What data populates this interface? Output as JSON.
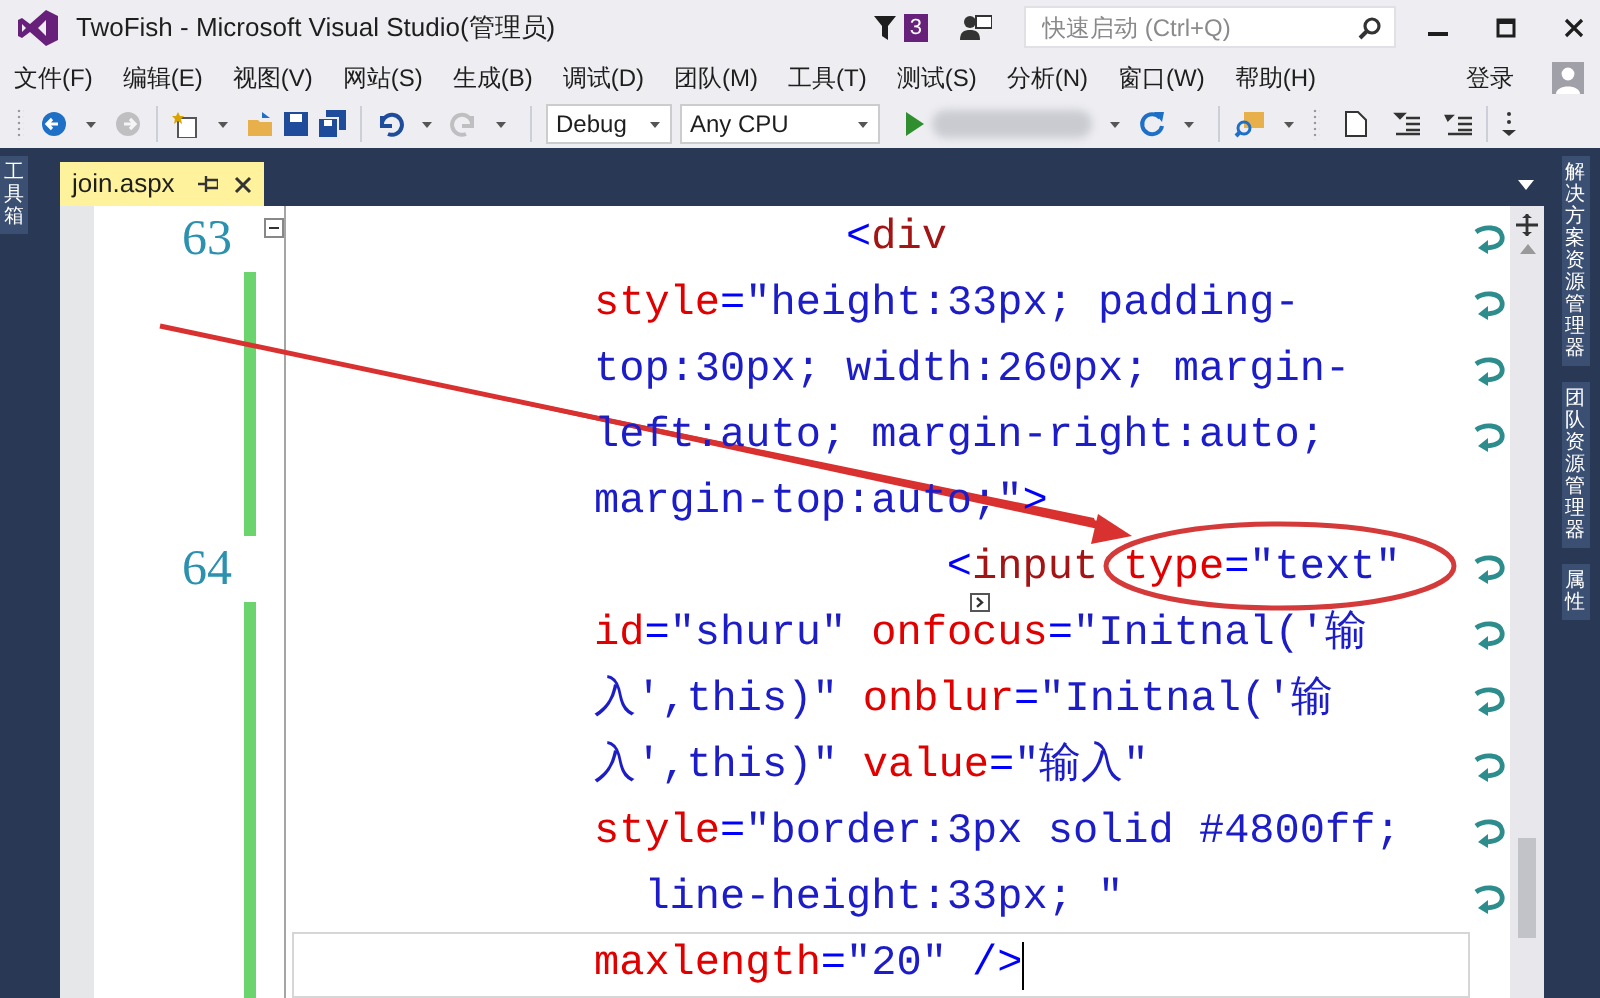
{
  "window": {
    "title": "TwoFish - Microsoft Visual Studio(管理员)",
    "notification_count": "3",
    "quick_launch": {
      "placeholder": "快速启动 (Ctrl+Q)"
    }
  },
  "menu": [
    "文件(F)",
    "编辑(E)",
    "视图(V)",
    "网站(S)",
    "生成(B)",
    "调试(D)",
    "团队(M)",
    "工具(T)",
    "测试(S)",
    "分析(N)",
    "窗口(W)",
    "帮助(H)"
  ],
  "sign_in": "登录",
  "toolbar": {
    "buttons": [
      {
        "kind": "back",
        "disabled": false
      },
      {
        "kind": "forward",
        "disabled": true
      },
      {
        "kind": "new",
        "disabled": false
      },
      {
        "kind": "open",
        "disabled": false
      },
      {
        "kind": "save",
        "disabled": false
      },
      {
        "kind": "save_all",
        "disabled": false
      },
      {
        "kind": "undo",
        "disabled": false
      },
      {
        "kind": "redo",
        "disabled": true
      }
    ],
    "configuration": "Debug",
    "platform": "Any CPU"
  },
  "left_panel": {
    "label": "工具箱"
  },
  "tabs": [
    {
      "label": "join.aspx",
      "selected": true
    }
  ],
  "editor": {
    "lines": [
      {
        "number": "63",
        "collapse_box": {
          "expanded": true
        },
        "changed": true,
        "rows": [
          {
            "current": false,
            "segments": [
              {
                "kind": "punct",
                "text": "          <"
              },
              {
                "kind": "tag",
                "text": "div"
              }
            ]
          },
          {
            "current": false,
            "segments": [
              {
                "kind": "attr",
                "text": "style"
              },
              {
                "kind": "punct",
                "text": "="
              },
              {
                "kind": "value",
                "text": "\"height:33px; padding-"
              }
            ]
          },
          {
            "current": false,
            "segments": [
              {
                "kind": "value",
                "text": "top:30px; width:260px; margin-"
              }
            ]
          },
          {
            "current": false,
            "segments": [
              {
                "kind": "value",
                "text": "left:auto; margin-right:auto;"
              }
            ]
          },
          {
            "current": false,
            "segments": [
              {
                "kind": "value",
                "text": "margin-top:auto;\""
              },
              {
                "kind": "punct",
                "text": ">"
              }
            ]
          }
        ]
      },
      {
        "number": "64",
        "changed": true,
        "rows": [
          {
            "current": false,
            "segments": [
              {
                "kind": "punct",
                "text": "              <"
              },
              {
                "kind": "tag",
                "text": "input"
              },
              {
                "kind": "attr",
                "text": " type"
              },
              {
                "kind": "punct",
                "text": "="
              },
              {
                "kind": "value",
                "text": "\"text\""
              }
            ]
          },
          {
            "current": false,
            "segments": [
              {
                "kind": "attr",
                "text": "id"
              },
              {
                "kind": "punct",
                "text": "="
              },
              {
                "kind": "value",
                "text": "\"shuru\""
              },
              {
                "kind": "attr",
                "text": " onfocus"
              },
              {
                "kind": "punct",
                "text": "="
              },
              {
                "kind": "value",
                "text": "\"Initnal('输"
              }
            ]
          },
          {
            "current": false,
            "segments": [
              {
                "kind": "value",
                "text": "入',this)\""
              },
              {
                "kind": "attr",
                "text": " onblur"
              },
              {
                "kind": "punct",
                "text": "="
              },
              {
                "kind": "value",
                "text": "\"Initnal('输"
              }
            ]
          },
          {
            "current": false,
            "segments": [
              {
                "kind": "value",
                "text": "入',this)\""
              },
              {
                "kind": "attr",
                "text": " value"
              },
              {
                "kind": "punct",
                "text": "="
              },
              {
                "kind": "value",
                "text": "\"输入\""
              }
            ]
          },
          {
            "current": false,
            "segments": [
              {
                "kind": "attr",
                "text": "style"
              },
              {
                "kind": "punct",
                "text": "="
              },
              {
                "kind": "value",
                "text": "\"border:3px solid #4800ff;"
              }
            ]
          },
          {
            "current": false,
            "segments": [
              {
                "kind": "value",
                "text": "  line-height:33px; \""
              }
            ]
          },
          {
            "current": true,
            "segments": [
              {
                "kind": "attr",
                "text": "maxlength"
              },
              {
                "kind": "punct",
                "text": "="
              },
              {
                "kind": "value",
                "text": "\"20\""
              },
              {
                "kind": "punct",
                "text": " />"
              }
            ]
          }
        ]
      }
    ]
  },
  "right_panel": {
    "labels": [
      "解决方案资源管理器",
      "团队资源管理器",
      "属性"
    ]
  }
}
